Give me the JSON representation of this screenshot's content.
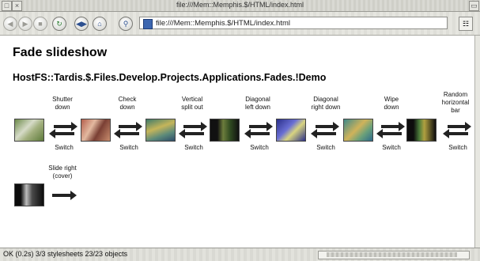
{
  "window": {
    "title": "file:///Mem::Memphis.$/HTML/index.html"
  },
  "toolbar": {
    "url": "file:///Mem::Memphis.$/HTML/index.html"
  },
  "page": {
    "heading": "Fade slideshow",
    "path": "HostFS::Tardis.$.Files.Develop.Projects.Applications.Fades.!Demo",
    "transitions_row1": [
      {
        "label_line1": "Shutter",
        "label_line2": "down"
      },
      {
        "label_line1": "Check",
        "label_line2": "down"
      },
      {
        "label_line1": "Vertical",
        "label_line2": "split out"
      },
      {
        "label_line1": "Diagonal",
        "label_line2": "left down"
      },
      {
        "label_line1": "Diagonal",
        "label_line2": "right down"
      },
      {
        "label_line1": "Wipe",
        "label_line2": "down"
      },
      {
        "label_line1": "Random",
        "label_line2": "horizontal",
        "label_line3": "bar"
      }
    ],
    "switch_label": "Switch",
    "transitions_row2": [
      {
        "label_line1": "Slide right",
        "label_line2": "(cover)"
      }
    ]
  },
  "status": {
    "text": "OK (0.2s) 3/3 stylesheets 23/23 objects"
  }
}
